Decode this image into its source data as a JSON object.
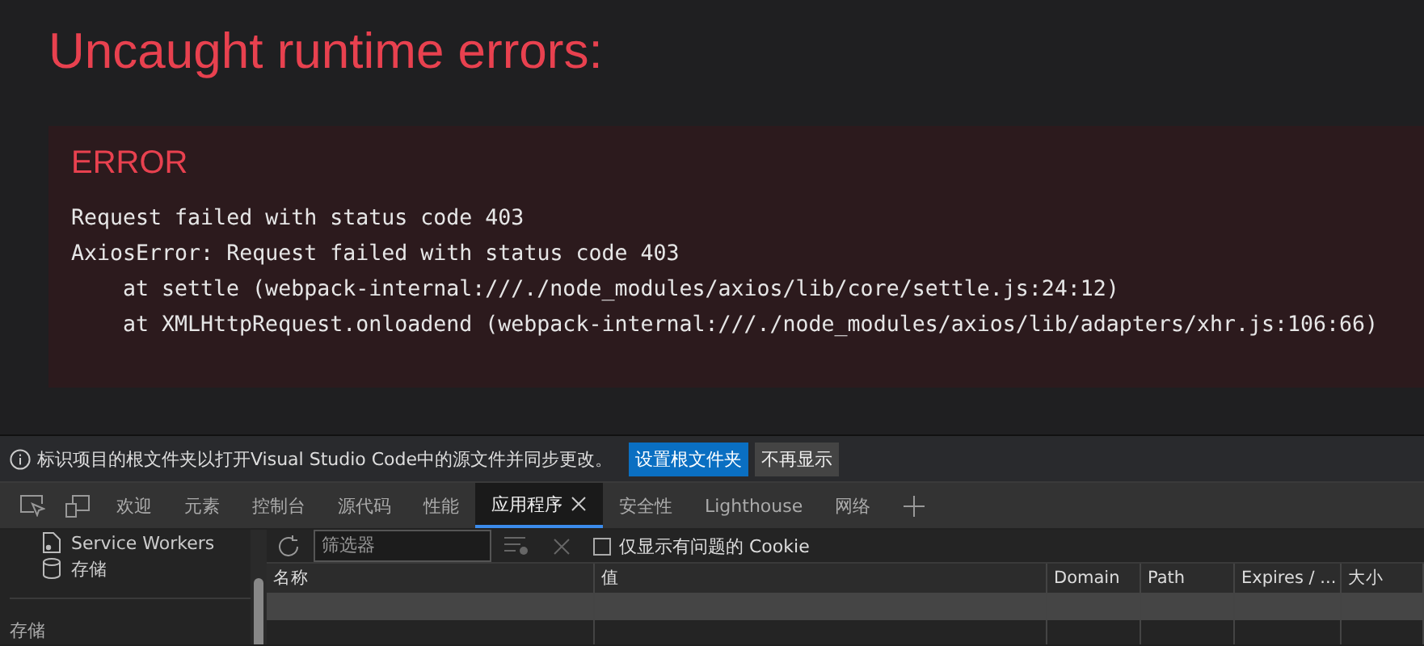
{
  "overlay": {
    "title": "Uncaught runtime errors:",
    "error": {
      "label": "ERROR",
      "lines": [
        {
          "kind": "message",
          "text": "Request failed with status code 403"
        },
        {
          "kind": "message",
          "text": "AxiosError: Request failed with status code 403"
        },
        {
          "kind": "frame",
          "text": "at settle (webpack-internal:///./node_modules/axios/lib/core/settle.js:24:12)"
        },
        {
          "kind": "frame",
          "text": "at XMLHttpRequest.onloadend (webpack-internal:///./node_modules/axios/lib/adapters/xhr.js:106:66)"
        }
      ]
    }
  },
  "infobar": {
    "message": "标识项目的根文件夹以打开Visual Studio Code中的源文件并同步更改。",
    "primary_button": "设置根文件夹",
    "secondary_button": "不再显示"
  },
  "tabs": [
    {
      "label": "欢迎",
      "selected": false
    },
    {
      "label": "元素",
      "selected": false
    },
    {
      "label": "控制台",
      "selected": false
    },
    {
      "label": "源代码",
      "selected": false
    },
    {
      "label": "性能",
      "selected": false
    },
    {
      "label": "应用程序",
      "selected": true
    },
    {
      "label": "安全性",
      "selected": false
    },
    {
      "label": "Lighthouse",
      "selected": false
    },
    {
      "label": "网络",
      "selected": false
    }
  ],
  "sidebar": {
    "items": [
      {
        "kind": "worker",
        "label": "Service Workers"
      },
      {
        "kind": "storage",
        "label": "存储"
      }
    ],
    "section": "存储"
  },
  "toolbar": {
    "filter_placeholder": "筛选器",
    "only_issues": {
      "label": "仅显示有问题的 Cookie",
      "checked": false
    }
  },
  "table": {
    "columns": [
      "名称",
      "值",
      "Domain",
      "Path",
      "Expires / ...",
      "大小"
    ]
  }
}
